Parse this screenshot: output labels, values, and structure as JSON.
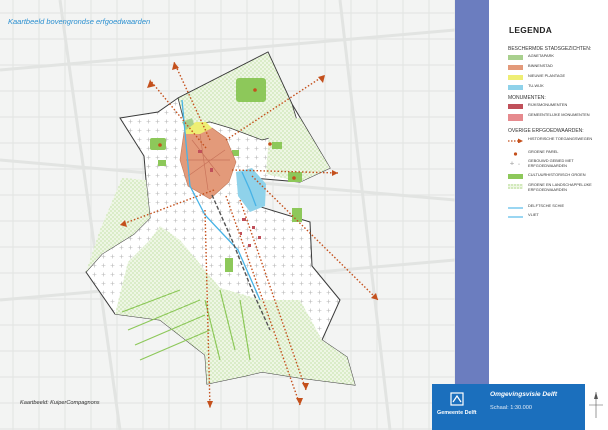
{
  "map": {
    "title": "Kaartbeeld bovengrondse erfgoedwaarden",
    "credit": "Kaartbeeld: KuiperCompagnons"
  },
  "legend": {
    "title": "LEGENDA",
    "sections": [
      {
        "heading": "BESCHERMDE STADSGEZICHTEN:",
        "items": [
          {
            "label": "AGNETAPARK",
            "symbol": "fill",
            "color": "#a9d08e"
          },
          {
            "label": "BINNENSTAD",
            "symbol": "fill",
            "color": "#e39a7a"
          },
          {
            "label": "NIEUWE PLANTAGE",
            "symbol": "fill",
            "color": "#eeee74"
          },
          {
            "label": "TU-WIJK",
            "symbol": "fill",
            "color": "#8fd2ea"
          }
        ]
      },
      {
        "heading": "MONUMENTEN:",
        "items": [
          {
            "label": "RIJKSMONUMENTEN",
            "symbol": "fill",
            "color": "#c0505a"
          },
          {
            "label": "GEMEENTELIJKE MONUMENTEN",
            "symbol": "fill",
            "color": "#e68a8e"
          }
        ]
      },
      {
        "heading": "OVERIGE ERFGOEDWAARDEN:",
        "items": [
          {
            "label": "HISTORISCHE TOEGANGSWEGEN",
            "symbol": "arrow",
            "color": "#c4501c"
          },
          {
            "label": "GROENE PAREL",
            "symbol": "dot",
            "color": "#c4501c"
          },
          {
            "label": "GEBOUWD GEBIED MET ERFGOEDWAARDEN",
            "symbol": "cross",
            "color": "#999999"
          },
          {
            "label": "CULTUURHISTORISCH GROEN",
            "symbol": "fill",
            "color": "#8dc85a"
          },
          {
            "label": "GROENE EN LANDSCHAPPELIJKE ERFGOEDWAARDEN",
            "symbol": "hatch",
            "color": "#a6d27a"
          },
          {
            "label": "DELFTSCHE SCHIE",
            "symbol": "line",
            "color": "#47b3e6"
          },
          {
            "label": "VLIET",
            "symbol": "line",
            "color": "#47b3e6"
          }
        ]
      }
    ]
  },
  "footer": {
    "logo_text": "Gemeente Delft",
    "title": "Omgevingsvisie Delft",
    "scale": "Schaal: 1:30.000",
    "color": "#1b6fbd"
  },
  "colors": {
    "boundary": "#3a3a3a",
    "access_roads": "#c4501c",
    "water": "#47b3e6",
    "sidebar": "#6b7dbf"
  }
}
